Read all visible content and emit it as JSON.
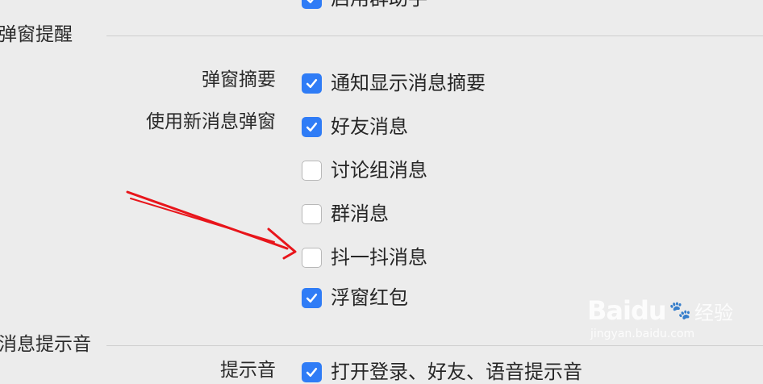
{
  "top_partial": {
    "label": "启用群助手",
    "checked": true
  },
  "sections": {
    "popup_title": "弹窗提醒",
    "sound_title": "消息提示音"
  },
  "popup": {
    "summary_label": "弹窗摘要",
    "new_popup_label": "使用新消息弹窗",
    "options": [
      {
        "label": "通知显示消息摘要",
        "checked": true
      },
      {
        "label": "好友消息",
        "checked": true
      },
      {
        "label": "讨论组消息",
        "checked": false
      },
      {
        "label": "群消息",
        "checked": false
      },
      {
        "label": "抖一抖消息",
        "checked": false
      },
      {
        "label": "浮窗红包",
        "checked": true
      }
    ]
  },
  "sound": {
    "row_label": "提示音",
    "first_option": {
      "label": "打开登录、好友、语音提示音",
      "checked": true
    }
  },
  "annotation": {
    "arrow_color": "#e8151b"
  },
  "watermark": {
    "brand": "Baidu",
    "brand_cn": "经验",
    "url": "jingyan.baidu.com"
  },
  "colors": {
    "checkbox_on": "#2f7cf6",
    "background": "#ececec"
  }
}
